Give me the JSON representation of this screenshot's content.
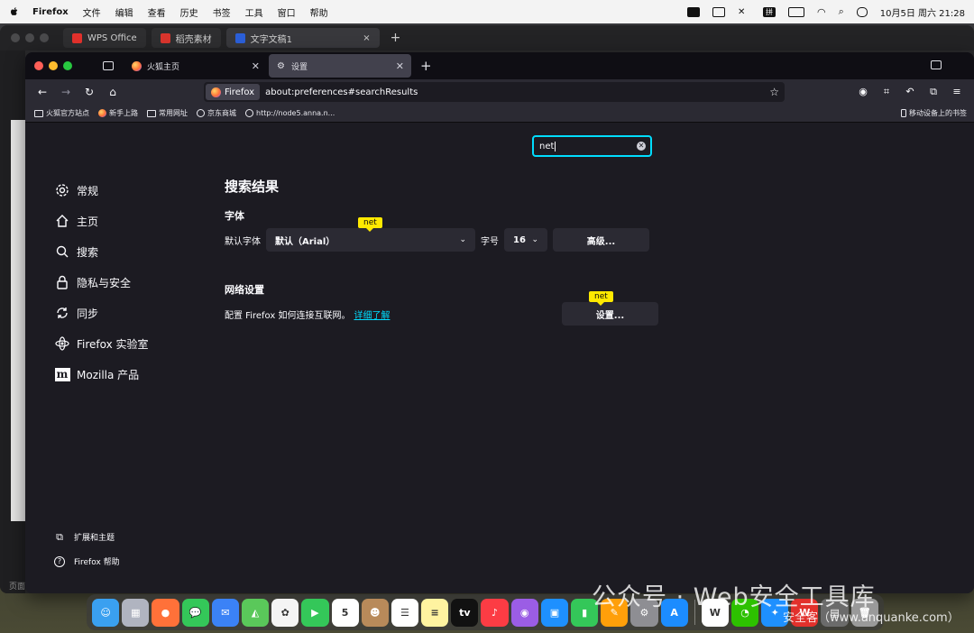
{
  "menubar": {
    "app_name": "Firefox",
    "items": [
      "文件",
      "编辑",
      "查看",
      "历史",
      "书签",
      "工具",
      "窗口",
      "帮助"
    ],
    "ime_label": "拼",
    "datetime": "10月5日 周六 21:28"
  },
  "wps": {
    "tabs": [
      {
        "label": "WPS Office",
        "icon_color": "#e2312c"
      },
      {
        "label": "稻壳素材",
        "icon_color": "#d9352d"
      },
      {
        "label": "文字文稿1",
        "icon_color": "#2b5fd9"
      }
    ],
    "footer_label": "页面"
  },
  "firefox": {
    "tabs": [
      {
        "label": "火狐主页",
        "icon": "firefox-icon"
      },
      {
        "label": "设置",
        "icon": "gear-icon",
        "active": true
      }
    ],
    "urlbar": {
      "identity": "Firefox",
      "url": "about:preferences#searchResults"
    },
    "bookmarks": [
      {
        "label": "火狐官方站点",
        "icon": "folder-icon"
      },
      {
        "label": "新手上路",
        "icon": "firefox-icon"
      },
      {
        "label": "常用网址",
        "icon": "folder-icon"
      },
      {
        "label": "京东商城",
        "icon": "globe-icon"
      },
      {
        "label": "http://node5.anna.n...",
        "icon": "globe-icon"
      }
    ],
    "mobile_bookmarks": "移动设备上的书签"
  },
  "preferences": {
    "search_value": "net",
    "sidebar": [
      {
        "label": "常规",
        "icon": "gear-icon"
      },
      {
        "label": "主页",
        "icon": "home-icon"
      },
      {
        "label": "搜索",
        "icon": "search-icon"
      },
      {
        "label": "隐私与安全",
        "icon": "lock-icon"
      },
      {
        "label": "同步",
        "icon": "sync-icon"
      },
      {
        "label": "Firefox 实验室",
        "icon": "labs-icon"
      },
      {
        "label": "Mozilla 产品",
        "icon": "mozilla-icon"
      }
    ],
    "sidebar_bottom": [
      {
        "label": "扩展和主题",
        "icon": "puzzle-icon"
      },
      {
        "label": "Firefox 帮助",
        "icon": "help-icon"
      }
    ],
    "results_title": "搜索结果",
    "fonts": {
      "heading": "字体",
      "default_font_label": "默认字体",
      "default_font_value": "默认（Arial）",
      "size_label": "字号",
      "size_value": "16",
      "advanced_button": "高级..."
    },
    "network": {
      "heading": "网络设置",
      "description": "配置 Firefox 如何连接互联网。",
      "learn_more": "详细了解",
      "settings_button": "设置..."
    },
    "highlight_tag": "net"
  },
  "dock": {
    "apps": [
      {
        "name": "finder",
        "color": "#3aa0f0",
        "glyph": "☺"
      },
      {
        "name": "launchpad",
        "color": "#b0b4c0",
        "glyph": "▦"
      },
      {
        "name": "firefox",
        "color": "#ff7139",
        "glyph": "●"
      },
      {
        "name": "messages",
        "color": "#34c759",
        "glyph": "💬"
      },
      {
        "name": "mail",
        "color": "#3b82f6",
        "glyph": "✉"
      },
      {
        "name": "maps",
        "color": "#5ac85a",
        "glyph": "◭"
      },
      {
        "name": "photos",
        "color": "#f4f4f4",
        "glyph": "✿"
      },
      {
        "name": "facetime",
        "color": "#34c759",
        "glyph": "▶"
      },
      {
        "name": "calendar",
        "color": "#ffffff",
        "glyph": "5"
      },
      {
        "name": "contacts",
        "color": "#b88a5a",
        "glyph": "☻"
      },
      {
        "name": "reminders",
        "color": "#ffffff",
        "glyph": "☰"
      },
      {
        "name": "notes",
        "color": "#fff3a0",
        "glyph": "≡"
      },
      {
        "name": "tv",
        "color": "#111111",
        "glyph": "tv"
      },
      {
        "name": "music",
        "color": "#fc3c44",
        "glyph": "♪"
      },
      {
        "name": "podcasts",
        "color": "#9b5de5",
        "glyph": "◉"
      },
      {
        "name": "keynote",
        "color": "#1e90ff",
        "glyph": "▣"
      },
      {
        "name": "numbers",
        "color": "#34c759",
        "glyph": "▮"
      },
      {
        "name": "pages",
        "color": "#ff9f0a",
        "glyph": "✎"
      },
      {
        "name": "system-settings",
        "color": "#8e8e93",
        "glyph": "⚙"
      },
      {
        "name": "app-store",
        "color": "#1c8cff",
        "glyph": "A"
      },
      {
        "name": "wps",
        "color": "#ffffff",
        "glyph": "W"
      },
      {
        "name": "wechat",
        "color": "#2dc100",
        "glyph": "◔"
      },
      {
        "name": "safari",
        "color": "#1e90ff",
        "glyph": "✦"
      },
      {
        "name": "wps-red",
        "color": "#e2312c",
        "glyph": "W"
      },
      {
        "name": "preview",
        "color": "#6b6b6b",
        "glyph": "▤"
      },
      {
        "name": "trash",
        "color": "#9a9a9a",
        "glyph": "🗑"
      }
    ]
  },
  "watermark": {
    "line1": "公众号 · Web安全工具库",
    "line2": "安全客（www.anquanke.com）"
  }
}
